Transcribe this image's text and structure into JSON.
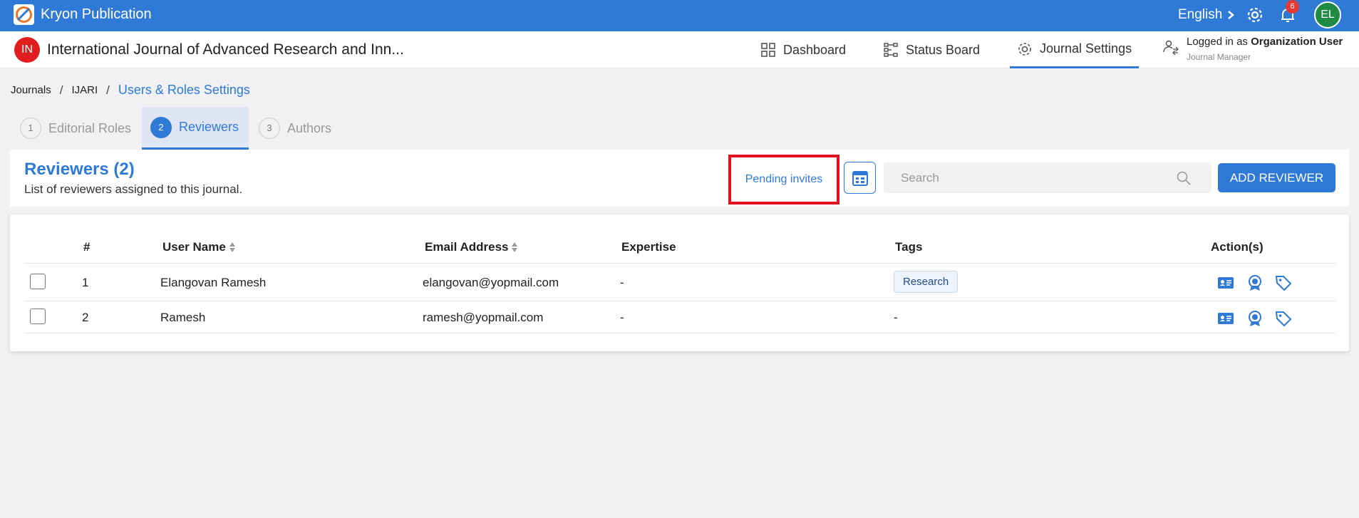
{
  "app": {
    "name": "Kryon Publication",
    "language": "English",
    "notification_count": "6",
    "avatar_initials": "EL"
  },
  "journal": {
    "badge": "IN",
    "title": "International Journal of Advanced Research and Inn...",
    "nav": {
      "dashboard": "Dashboard",
      "status_board": "Status Board",
      "journal_settings": "Journal Settings"
    },
    "logged_in_prefix": "Logged in as",
    "logged_in_user": "Organization User",
    "role": "Journal Manager"
  },
  "breadcrumb": {
    "journals": "Journals",
    "sep": "/",
    "code": "IJARI",
    "current": "Users & Roles Settings"
  },
  "steps": [
    {
      "num": "1",
      "label": "Editorial Roles"
    },
    {
      "num": "2",
      "label": "Reviewers"
    },
    {
      "num": "3",
      "label": "Authors"
    }
  ],
  "reviewers": {
    "title": "Reviewers (2)",
    "subtitle": "List of reviewers assigned to this journal.",
    "pending_invites": "Pending invites",
    "search_placeholder": "Search",
    "add_button": "ADD REVIEWER"
  },
  "table": {
    "headers": {
      "num": "#",
      "user_name": "User Name",
      "email": "Email Address",
      "expertise": "Expertise",
      "tags": "Tags",
      "actions": "Action(s)"
    },
    "rows": [
      {
        "num": "1",
        "name": "Elangovan Ramesh",
        "email": "elangovan@yopmail.com",
        "expertise": "-",
        "tag": "Research"
      },
      {
        "num": "2",
        "name": "Ramesh",
        "email": "ramesh@yopmail.com",
        "expertise": "-",
        "tag": "-"
      }
    ]
  },
  "colors": {
    "primary": "#2f7ad6",
    "highlight": "#e0101d",
    "background": "#f1f1f4"
  }
}
